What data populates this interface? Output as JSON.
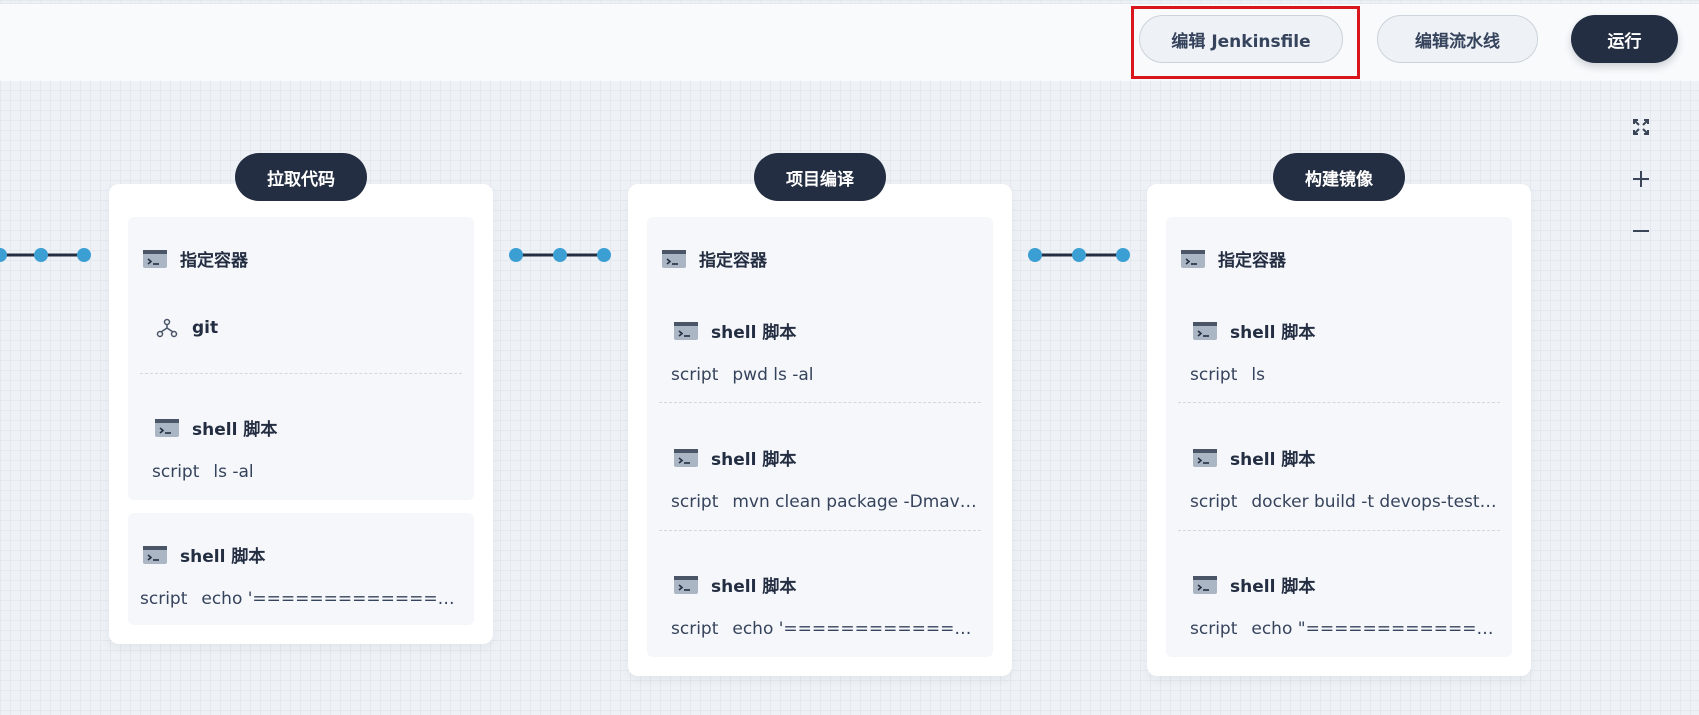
{
  "toolbar": {
    "edit_jenkinsfile": "编辑 Jenkinsfile",
    "edit_pipeline": "编辑流水线",
    "run": "运行"
  },
  "zoom_tools": [
    "fullscreen-icon",
    "zoom-in-icon",
    "zoom-out-icon"
  ],
  "colors": {
    "dark": "#242e42",
    "connector_dot": "#3c9fd4",
    "highlight": "#d9161c"
  },
  "stages": [
    {
      "title": "拉取代码",
      "container_label": "指定容器",
      "nested": [
        {
          "icon": "git-icon",
          "label": "git",
          "script": null
        },
        {
          "icon": "terminal-icon",
          "label": "shell 脚本",
          "script_key": "script",
          "script": "ls -al"
        }
      ],
      "steps": [
        {
          "label": "shell 脚本",
          "script_key": "script",
          "script": "echo '============== cloning code ==============='"
        }
      ]
    },
    {
      "title": "项目编译",
      "container_label": "指定容器",
      "nested": [
        {
          "icon": "terminal-icon",
          "label": "shell 脚本",
          "script_key": "script",
          "script": "pwd ls -al"
        },
        {
          "icon": "terminal-icon",
          "label": "shell 脚本",
          "script_key": "script",
          "script": "mvn clean package -Dmaven.test.skip=true"
        },
        {
          "icon": "terminal-icon",
          "label": "shell 脚本",
          "script_key": "script",
          "script": "echo '============= build end ============='"
        }
      ],
      "steps": []
    },
    {
      "title": "构建镜像",
      "container_label": "指定容器",
      "nested": [
        {
          "icon": "terminal-icon",
          "label": "shell 脚本",
          "script_key": "script",
          "script": "ls"
        },
        {
          "icon": "terminal-icon",
          "label": "shell 脚本",
          "script_key": "script",
          "script": "docker build -t devops-test:latest ."
        },
        {
          "icon": "terminal-icon",
          "label": "shell 脚本",
          "script_key": "script",
          "script": "echo \"============= build image end =============\""
        }
      ],
      "steps": []
    }
  ]
}
